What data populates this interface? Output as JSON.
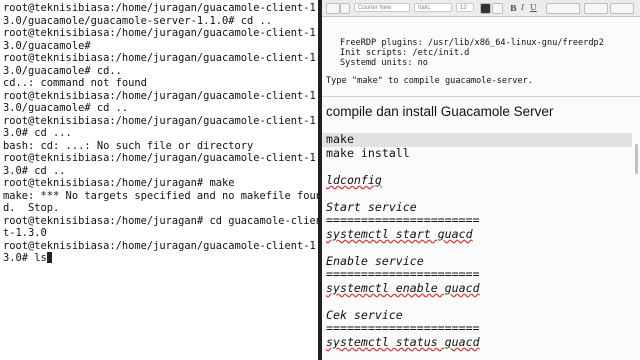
{
  "terminal": {
    "lines": [
      "root@teknisibiasa:/home/juragan/guacamole-client-1.",
      "3.0/guacamole/guacamole-server-1.1.0# cd ..",
      "root@teknisibiasa:/home/juragan/guacamole-client-1.",
      "3.0/guacamole#",
      "root@teknisibiasa:/home/juragan/guacamole-client-1.",
      "3.0/guacamole# cd..",
      "cd..: command not found",
      "root@teknisibiasa:/home/juragan/guacamole-client-1.",
      "3.0/guacamole# cd ..",
      "root@teknisibiasa:/home/juragan/guacamole-client-1.",
      "3.0# cd ...",
      "bash: cd: ...: No such file or directory",
      "root@teknisibiasa:/home/juragan/guacamole-client-1.",
      "3.0# cd ..",
      "root@teknisibiasa:/home/juragan# make",
      "make: *** No targets specified and no makefile foun",
      "d.  Stop.",
      "root@teknisibiasa:/home/juragan# cd guacamole-client",
      "t-1.3.0",
      "root@teknisibiasa:/home/juragan/guacamole-client-1.",
      "3.0# ls"
    ]
  },
  "editor": {
    "toolbar": {
      "font_name": "Courier New",
      "font_style": "Italic",
      "font_size": "12"
    },
    "top_lines": [
      "FreeRDP plugins: /usr/lib/x86_64-linux-gnu/freerdp2",
      "Init scripts: /etc/init.d",
      "Systemd units: no"
    ],
    "type_make_note": "Type \"make\" to compile guacamole-server.",
    "heading": "compile dan install Guacamole Server",
    "cmd_make": "make",
    "cmd_make_install": "make install",
    "cmd_ldconfig": "ldconfig",
    "start_label": "Start service",
    "separator": "======================",
    "cmd_start": "systemctl start guacd",
    "enable_label": "Enable service",
    "cmd_enable": "systemctl enable guacd",
    "cek_label": "Cek service",
    "cmd_status": "systemctl status guacd"
  }
}
